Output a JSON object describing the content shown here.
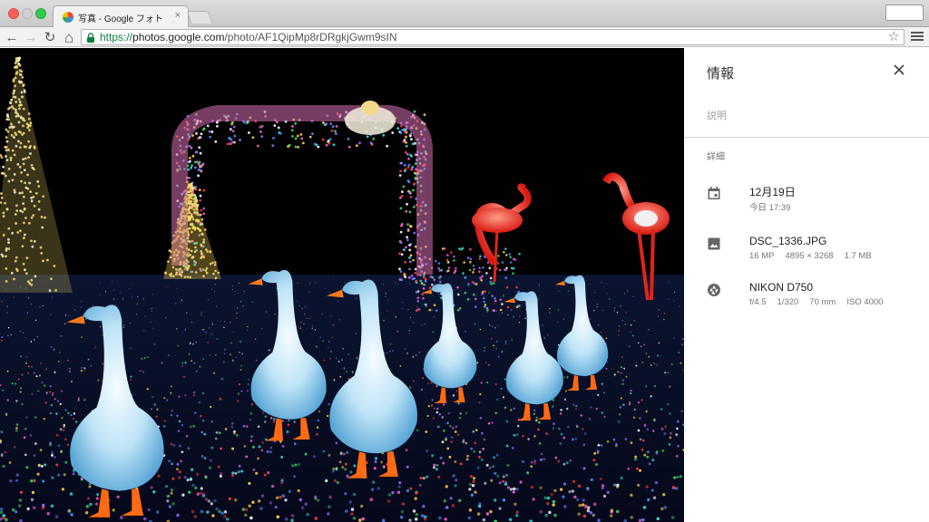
{
  "browser": {
    "tab": {
      "title": "写真 - Google フォト",
      "close_glyph": "×",
      "favicon": "google-photos-pinwheel-icon"
    },
    "toolbar": {
      "back_glyph": "←",
      "forward_glyph": "→",
      "reload_glyph": "↻",
      "home_glyph": "⌂",
      "star_glyph": "☆"
    },
    "address": {
      "scheme": "https://",
      "host": "photos.google.com",
      "path": "/photo/AF1QipMp8rDRgkjGwm9sIN"
    }
  },
  "photo": {
    "description": "illumination-photo-of-white-geese-and-pink-flamingos"
  },
  "info_panel": {
    "title": "情報",
    "close_glyph": "×",
    "description_placeholder": "説明",
    "details_label": "詳細",
    "date": {
      "main": "12月19日",
      "sub": "今日 17:39",
      "icon": "calendar-icon"
    },
    "file": {
      "name": "DSC_1336.JPG",
      "megapixels": "16 MP",
      "dimensions": "4895 × 3268",
      "size": "1.7 MB",
      "icon": "image-icon"
    },
    "camera": {
      "model": "NIKON D750",
      "aperture": "f/4.5",
      "shutter": "1/320",
      "focal_length": "70 mm",
      "iso": "ISO 4000",
      "icon": "aperture-icon"
    }
  },
  "colors": {
    "url_secure": "#0b8043",
    "panel_bg": "#ffffff",
    "photo_bg": "#000000",
    "secondary_text": "#757575"
  }
}
